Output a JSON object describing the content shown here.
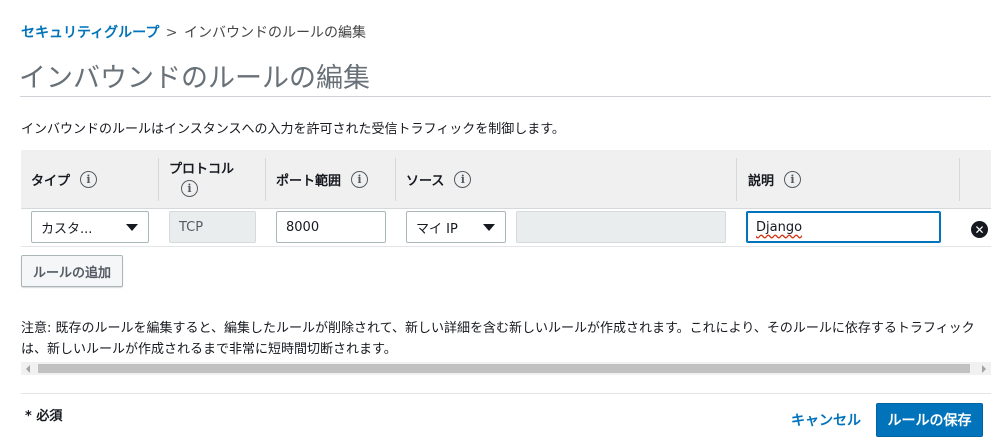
{
  "breadcrumb": {
    "parent": "セキュリティグループ",
    "separator": ">",
    "current": "インバウンドのルールの編集"
  },
  "page_title": "インバウンドのルールの編集",
  "description": "インバウンドのルールはインスタンスへの入力を許可された受信トラフィックを制御します。",
  "table": {
    "columns": [
      {
        "label": "タイプ",
        "icon": "info-icon"
      },
      {
        "label": "プロトコル",
        "icon": "info-icon"
      },
      {
        "label": "ポート範囲",
        "icon": "info-icon"
      },
      {
        "label": "ソース",
        "icon": "info-icon"
      },
      {
        "label": "説明",
        "icon": "info-icon"
      }
    ],
    "info_glyph": "i",
    "rows": [
      {
        "type": "カスタ...",
        "protocol": "TCP",
        "port_range": "8000",
        "source_type": "マイ IP",
        "source_value": "",
        "description": "Django",
        "remove_icon": "close-circle-icon"
      }
    ]
  },
  "add_rule_label": "ルールの追加",
  "note": "注意: 既存のルールを編集すると、編集したルールが削除されて、新しい詳細を含む新しいルールが作成されます。これにより、そのルールに依存するトラフィックは、新しいルールが作成されるまで非常に短時間切断されます。",
  "required_note": "* 必須",
  "footer": {
    "cancel_label": "キャンセル",
    "save_label": "ルールの保存"
  },
  "colors": {
    "link": "#0073bb",
    "primary_button": "#0073bb",
    "header_bg": "#f0f0f0"
  }
}
